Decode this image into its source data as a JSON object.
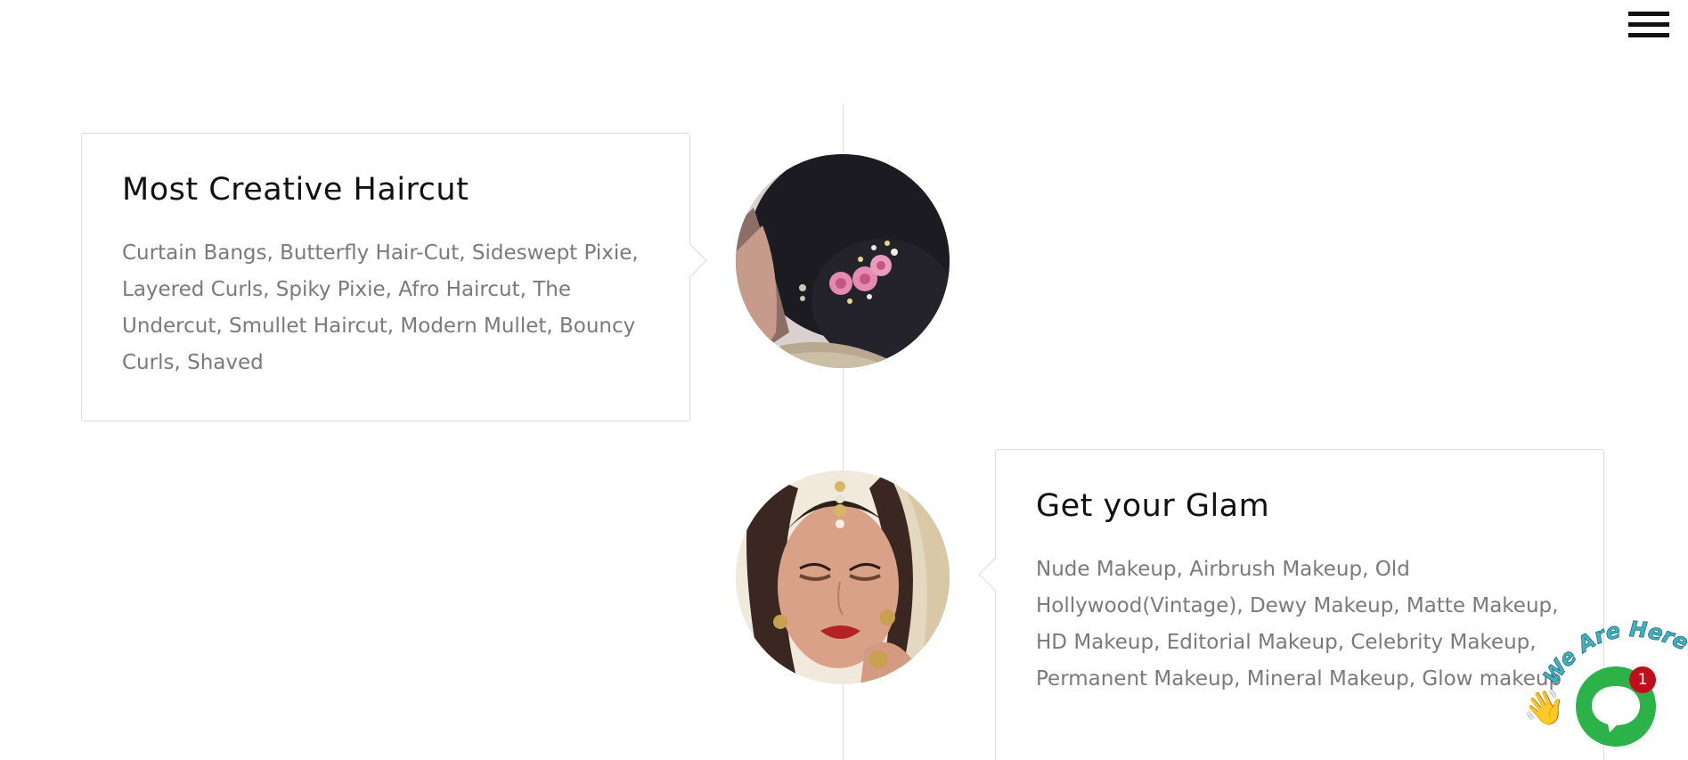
{
  "header": {
    "menu_icon": "hamburger-menu-icon"
  },
  "timeline": {
    "items": [
      {
        "title": "Most Creative Haircut",
        "description": "Curtain Bangs, Butterfly Hair-Cut, Sideswept Pixie, Layered Curls, Spiky Pixie, Afro Haircut, The Undercut, Smullet Haircut, Modern Mullet, Bouncy Curls, Shaved",
        "image_alt": "bridal-hairstyle-photo"
      },
      {
        "title": "Get your Glam",
        "description": "Nude Makeup, Airbrush Makeup, Old Hollywood(Vintage), Dewy Makeup, Matte Makeup, HD Makeup, Editorial Makeup, Celebrity Makeup, Permanent Makeup, Mineral Makeup, Glow makeup",
        "image_alt": "bridal-makeup-photo"
      }
    ]
  },
  "chat_widget": {
    "label": "We Are Here!",
    "badge_count": "1",
    "icon": "chat-bubble-icon",
    "brand_color": "#2bb34a",
    "badge_color": "#c00f1a"
  }
}
